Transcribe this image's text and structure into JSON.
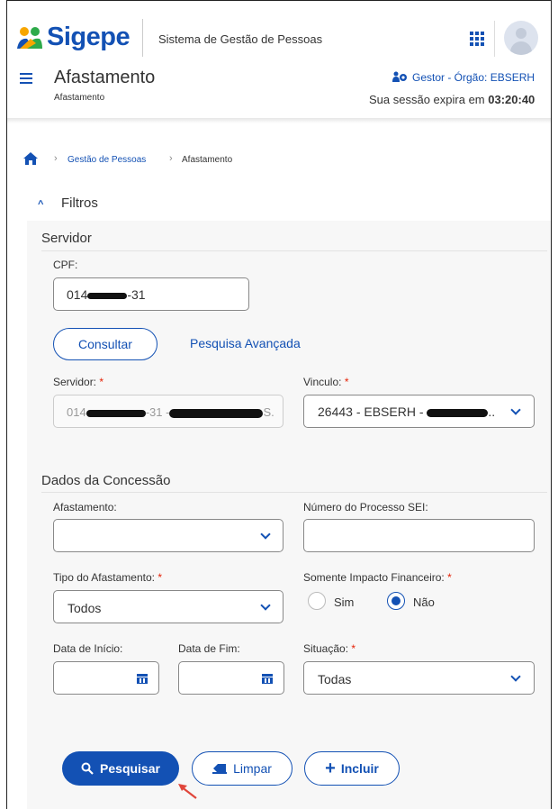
{
  "header": {
    "logo_text": "Sigepe",
    "system_name": "Sistema de Gestão de Pessoas",
    "page_title": "Afastamento",
    "page_subtitle": "Afastamento",
    "role": "Gestor - Órgão: EBSERH",
    "session_prefix": "Sua sessão expira em",
    "session_time": "03:20:40",
    "accent_color": "#1351b4"
  },
  "breadcrumb": {
    "items": [
      "Gestão de Pessoas",
      "Afastamento"
    ]
  },
  "filters": {
    "title": "Filtros",
    "servidor_section": {
      "title": "Servidor",
      "cpf_label": "CPF:",
      "cpf_prefix": "014",
      "cpf_suffix": "-31",
      "consultar_label": "Consultar",
      "pesquisa_avancada_label": "Pesquisa Avançada",
      "servidor_label": "Servidor:",
      "servidor_prefix": "014",
      "servidor_mid": "-31 -",
      "servidor_tail": "S.",
      "vinculo_label": "Vinculo:",
      "vinculo_prefix": "26443 - EBSERH -",
      "vinculo_tail": ".."
    },
    "concessao_section": {
      "title": "Dados da Concessão",
      "afastamento_label": "Afastamento:",
      "afastamento_value": "",
      "processo_label": "Número do Processo SEI:",
      "processo_value": "",
      "tipo_label": "Tipo do Afastamento:",
      "tipo_value": "Todos",
      "impacto_label": "Somente Impacto Financeiro:",
      "impacto_options": [
        "Sim",
        "Não"
      ],
      "impacto_selected": "Não",
      "data_inicio_label": "Data de Início:",
      "data_fim_label": "Data de Fim:",
      "situacao_label": "Situação:",
      "situacao_value": "Todas"
    },
    "required_mark": "*"
  },
  "actions": {
    "pesquisar_label": "Pesquisar",
    "limpar_label": "Limpar",
    "incluir_label": "Incluir"
  }
}
